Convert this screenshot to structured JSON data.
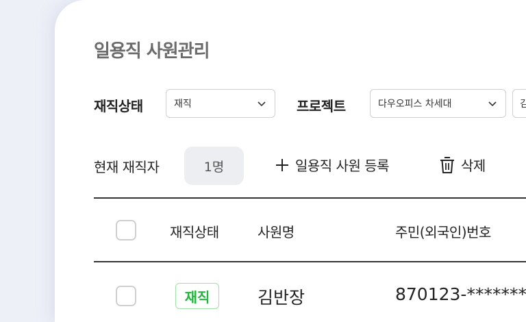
{
  "page": {
    "title": "일용직 사원관리"
  },
  "filters": {
    "status_label": "재직상태",
    "status_value": "재직",
    "project_label": "프로젝트",
    "project_value": "다우오피스 차세대",
    "extra_value": "김"
  },
  "summary": {
    "label": "현재 재직자",
    "count": "1명"
  },
  "actions": {
    "add_label": "일용직 사원 등록",
    "delete_label": "삭제"
  },
  "table": {
    "headers": [
      "재직상태",
      "사원명",
      "주민(외국인)번호"
    ],
    "rows": [
      {
        "status": "재직",
        "name": "김반장",
        "id_number": "870123-*******"
      }
    ]
  },
  "colors": {
    "status_active": "#22b43c",
    "status_border": "#9fe0a8",
    "badge_bg": "#eceef2",
    "page_bg": "#eef0f8"
  }
}
